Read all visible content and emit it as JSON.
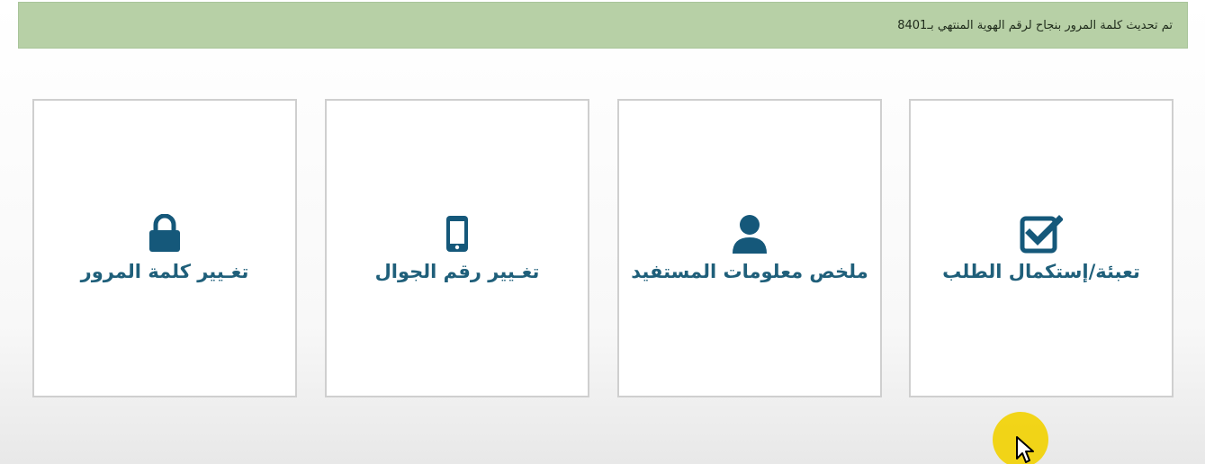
{
  "notification": {
    "message": "تم تحديث كلمة المرور بنجاح لرقم الهوية المنتهي بـ8401"
  },
  "tiles": [
    {
      "label": "تغـيير كلمة المرور",
      "icon": "lock-icon"
    },
    {
      "label": "تغـيير رقم الجوال",
      "icon": "mobile-phone-icon"
    },
    {
      "label": "ملخص معلومات المستفيد",
      "icon": "user-icon"
    },
    {
      "label": "تعبئة/إستكمال الطلب",
      "icon": "checkbox-checked-icon"
    }
  ],
  "colors": {
    "notification_bg": "#b7d0a6",
    "tile_text": "#1f5f7a",
    "icon": "#15587a",
    "tile_border": "#cfcfcf",
    "cursor_highlight": "#f2d200"
  }
}
